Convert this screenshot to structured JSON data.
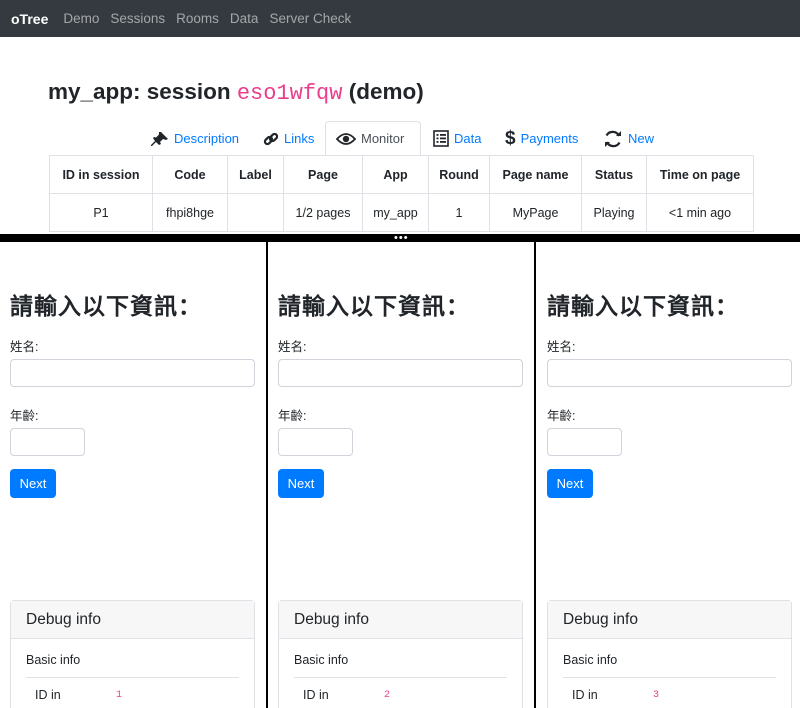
{
  "navbar": {
    "brand": "oTree",
    "links": [
      "Demo",
      "Sessions",
      "Rooms",
      "Data",
      "Server Check"
    ]
  },
  "session": {
    "prefix": "my_app: session",
    "code": "eso1wfqw",
    "suffix": "(demo)"
  },
  "tabs": [
    {
      "label": "Description",
      "icon": "pushpin-icon",
      "active": false
    },
    {
      "label": "Links",
      "icon": "link-icon",
      "active": false
    },
    {
      "label": "Monitor",
      "icon": "eye-icon",
      "active": true
    },
    {
      "label": "Data",
      "icon": "list-icon",
      "active": false
    },
    {
      "label": "Payments",
      "icon": "dollar-icon",
      "active": false
    },
    {
      "label": "New",
      "icon": "refresh-icon",
      "active": false
    }
  ],
  "monitor": {
    "headers": [
      "ID in session",
      "Code",
      "Label",
      "Page",
      "App",
      "Round",
      "Page name",
      "Status",
      "Time on page"
    ],
    "rows": [
      [
        "P1",
        "fhpi8hge",
        "",
        "1/2 pages",
        "my_app",
        "1",
        "MyPage",
        "Playing",
        "<1 min ago"
      ]
    ]
  },
  "panes": [
    {
      "heading": "請輸入以下資訊：",
      "name_label": "姓名:",
      "age_label": "年齡:",
      "next_label": "Next",
      "debug_title": "Debug info",
      "debug_sub": "Basic info",
      "debug_key": "ID in",
      "debug_value": "1"
    },
    {
      "heading": "請輸入以下資訊：",
      "name_label": "姓名:",
      "age_label": "年齡:",
      "next_label": "Next",
      "debug_title": "Debug info",
      "debug_sub": "Basic info",
      "debug_key": "ID in",
      "debug_value": "2"
    },
    {
      "heading": "請輸入以下資訊：",
      "name_label": "姓名:",
      "age_label": "年齡:",
      "next_label": "Next",
      "debug_title": "Debug info",
      "debug_sub": "Basic info",
      "debug_key": "ID in",
      "debug_value": "3"
    }
  ],
  "colors": {
    "navbar": "#343a40",
    "link": "#007bff",
    "code": "#e83e8c",
    "button": "#007bff"
  }
}
